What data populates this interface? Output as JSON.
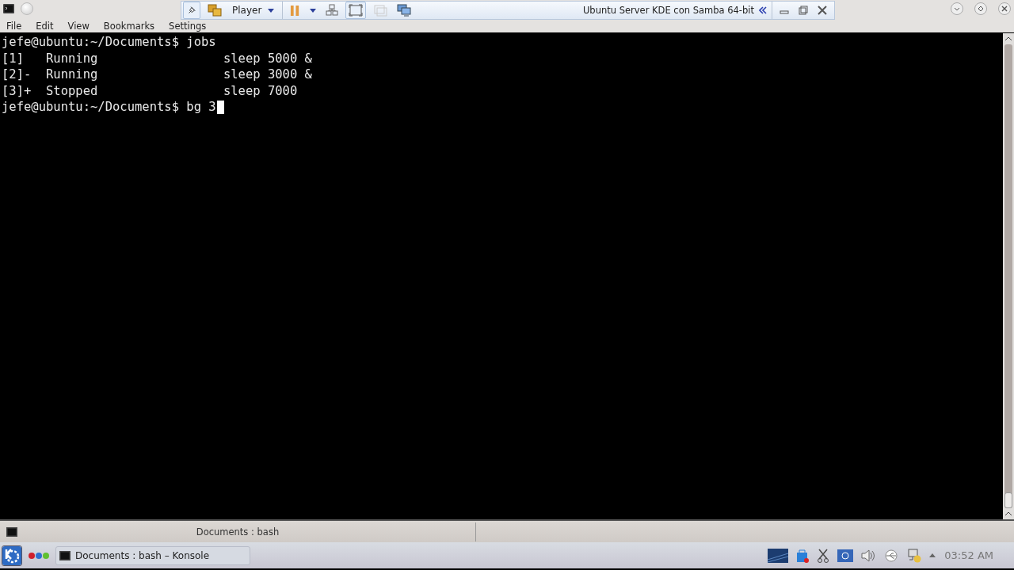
{
  "window": {
    "menu": [
      "File",
      "Edit",
      "View",
      "Bookmarks",
      "Settings"
    ]
  },
  "vm_toolbar": {
    "player_label": "Player",
    "vm_title": "Ubuntu Server KDE con Samba 64-bit"
  },
  "terminal": {
    "lines": [
      "jefe@ubuntu:~/Documents$ jobs",
      "[1]   Running                 sleep 5000 &",
      "[2]-  Running                 sleep 3000 &",
      "[3]+  Stopped                 sleep 7000",
      "jefe@ubuntu:~/Documents$ bg 3"
    ],
    "cursor": true
  },
  "tab_bar": {
    "tab": "Documents : bash"
  },
  "taskbar": {
    "task": "Documents : bash – Konsole",
    "clock": "03:52 AM"
  }
}
